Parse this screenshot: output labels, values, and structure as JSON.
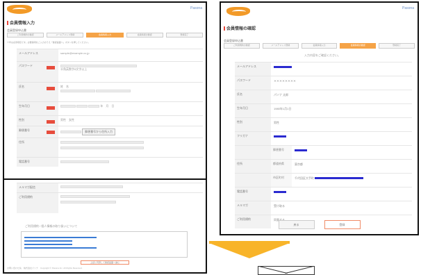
{
  "left_top": {
    "brand": "Pasona",
    "title": "会員情報入力",
    "subtitle": "会員登録申込書",
    "steps": [
      "ご利用規約の確認",
      "メールアドレス登録",
      "会員情報入力",
      "会員情報の確認",
      "登録完了"
    ],
    "active_step": 2,
    "note": "※印は必須項目です。必要事項をご入力のうえ「確認画面へ」ボタンを押してください。",
    "rows": [
      {
        "label": "メールアドレス",
        "value": "sample@example.co.jp",
        "required": false
      },
      {
        "label": "パスワード",
        "value": "半角英数字8文字以上",
        "required": true
      },
      {
        "label": "氏名",
        "value": "姓　名",
        "required": true
      },
      {
        "label": "生年月日",
        "value": "年　月　日",
        "required": true
      },
      {
        "label": "性別",
        "value": "男性　女性",
        "required": true
      },
      {
        "label": "郵便番号",
        "value": "",
        "required": true
      },
      {
        "label": "住所",
        "value": "",
        "required": false
      },
      {
        "label": "電話番号",
        "value": "",
        "required": false
      }
    ],
    "search_button": "郵便番号から住所入力"
  },
  "left_bottom": {
    "label_1": "メルマガ配信",
    "label_2": "ご利用規約",
    "heading": "ご利用規約 / 個人情報の取り扱いについて",
    "agree_button": "上記に同意して確認画面へ進む",
    "footer": "お問い合わせ先　株式会社パソナ　Copyright © Pasona Inc. All Rights Reserved."
  },
  "right_panel": {
    "brand": "Pasona",
    "title": "会員情報の確認",
    "subtitle": "会員登録申込書",
    "steps": [
      "ご利用規約の確認",
      "メールアドレス登録",
      "会員情報入力",
      "会員情報の確認",
      "登録完了"
    ],
    "active_step": 3,
    "note": "入力内容をご確認ください。",
    "rows": [
      {
        "label": "メールアドレス",
        "sub": "",
        "value": ""
      },
      {
        "label": "パスワード",
        "sub": "",
        "value": "＊＊＊＊＊＊＊＊"
      },
      {
        "label": "氏名",
        "sub": "",
        "value": "パソナ 太郎"
      },
      {
        "label": "生年月日",
        "sub": "",
        "value": "1980年1月1日"
      },
      {
        "label": "性別",
        "sub": "",
        "value": "男性"
      },
      {
        "label": "フリガナ",
        "sub": "",
        "value": ""
      },
      {
        "label": "",
        "sub": "郵便番号",
        "value": ""
      },
      {
        "label": "住所",
        "sub": "都道府県",
        "value": "東京都"
      },
      {
        "label": "",
        "sub": "市区町村",
        "value": "千代田区大手町"
      },
      {
        "label": "電話番号",
        "sub": "",
        "value": ""
      },
      {
        "label": "メルマガ",
        "sub": "",
        "value": "受け取る"
      },
      {
        "label": "ご利用規約",
        "sub": "",
        "value": "同意する"
      }
    ],
    "back_button": "戻る",
    "submit_button": "登録"
  },
  "colors": {
    "accent": "#f5a347",
    "arrow": "#f8b429",
    "required": "#e74c3c",
    "highlight": "#2a2ad0"
  }
}
